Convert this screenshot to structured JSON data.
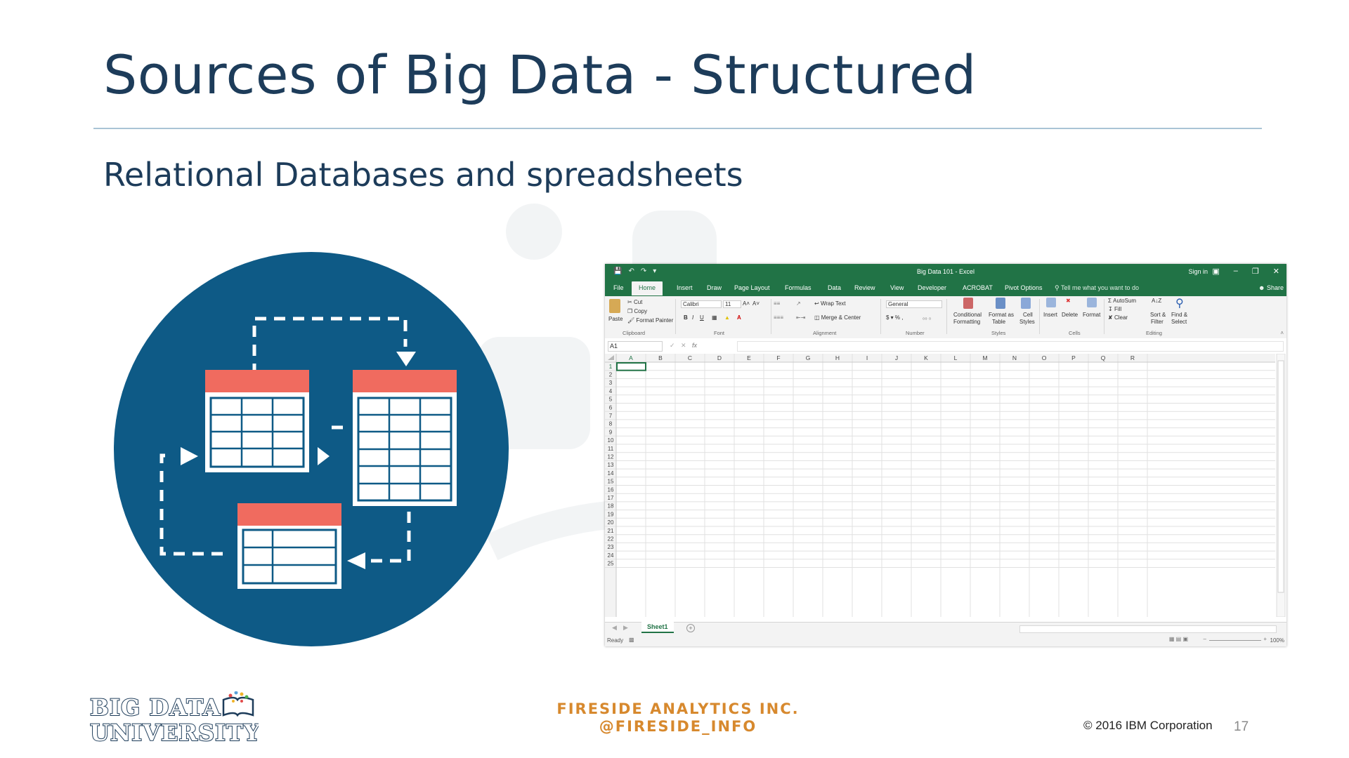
{
  "slide": {
    "title": "Sources of Big Data - Structured",
    "subtitle": "Relational Databases and spreadsheets",
    "page_number": "17",
    "copyright": "© 2016 IBM Corporation"
  },
  "footer": {
    "logo_line1": "BIG DATA",
    "logo_line2": "UNIVERSITY",
    "company_line1": "FIRESIDE ANALYTICS INC.",
    "company_line2": "@FIRESIDE_INFO"
  },
  "colors": {
    "title": "#1d3c5a",
    "circle": "#0e5a86",
    "table_header": "#f06b5f",
    "excel_green": "#217346",
    "fireside_orange": "#d7892e"
  },
  "excel": {
    "window_title": "Big Data 101 - Excel",
    "sign_in": "Sign in",
    "tabs": [
      "File",
      "Home",
      "Insert",
      "Draw",
      "Page Layout",
      "Formulas",
      "Data",
      "Review",
      "View",
      "Developer",
      "ACROBAT",
      "Pivot Options"
    ],
    "active_tab": "Home",
    "tell_me": "Tell me what you want to do",
    "share": "Share",
    "ribbon": {
      "paste": "Paste",
      "cut": "Cut",
      "copy": "Copy",
      "format_painter": "Format Painter",
      "font_name": "Calibri",
      "font_size": "11",
      "wrap_text": "Wrap Text",
      "merge_center": "Merge & Center",
      "number_format": "General",
      "conditional_formatting_1": "Conditional",
      "conditional_formatting_2": "Formatting",
      "format_as_table_1": "Format as",
      "format_as_table_2": "Table",
      "cell_styles_1": "Cell",
      "cell_styles_2": "Styles",
      "insert": "Insert",
      "delete": "Delete",
      "format": "Format",
      "autosum": "AutoSum",
      "fill": "Fill",
      "clear": "Clear",
      "sort_filter_1": "Sort &",
      "sort_filter_2": "Filter",
      "find_select_1": "Find &",
      "find_select_2": "Select",
      "groups": [
        "Clipboard",
        "Font",
        "Alignment",
        "Number",
        "Styles",
        "Cells",
        "Editing"
      ]
    },
    "name_box": "A1",
    "columns": [
      "A",
      "B",
      "C",
      "D",
      "E",
      "F",
      "G",
      "H",
      "I",
      "J",
      "K",
      "L",
      "M",
      "N",
      "O",
      "P",
      "Q",
      "R"
    ],
    "rows": [
      "1",
      "2",
      "3",
      "4",
      "5",
      "6",
      "7",
      "8",
      "9",
      "10",
      "11",
      "12",
      "13",
      "14",
      "15",
      "16",
      "17",
      "18",
      "19",
      "20",
      "21",
      "22",
      "23",
      "24",
      "25"
    ],
    "sheet_tab": "Sheet1",
    "status": "Ready",
    "zoom": "100%"
  }
}
